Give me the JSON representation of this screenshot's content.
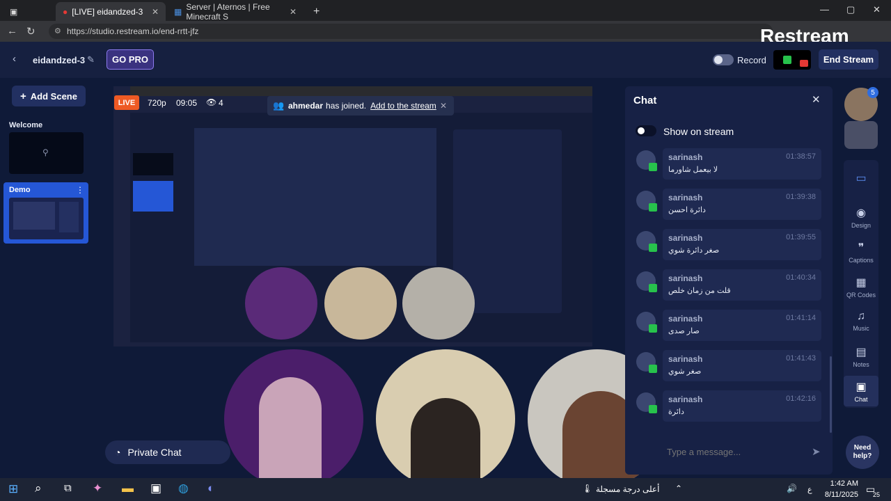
{
  "browser": {
    "tabs": [
      {
        "label": "[LIVE] eidandzed-3",
        "active": true
      },
      {
        "label": "Server | Aternos | Free Minecraft S",
        "active": false
      }
    ],
    "url": "https://studio.restream.io/end-rrtt-jfz",
    "logo": "Restream"
  },
  "header": {
    "project_name": "eidandzed-3",
    "go_pro": "GO PRO",
    "record_label": "Record",
    "end_stream": "End Stream"
  },
  "scenes": {
    "add_label": "Add Scene",
    "items": [
      {
        "label": "Welcome",
        "active": false
      },
      {
        "label": "Demo",
        "active": true
      }
    ]
  },
  "stage": {
    "live_badge": "LIVE",
    "resolution": "720p",
    "timer": "09:05",
    "viewers": "4",
    "toast_user": "ahmedar",
    "toast_text": "has joined.",
    "toast_link": "Add to the stream",
    "private_chat": "Private Chat"
  },
  "chat": {
    "title": "Chat",
    "show_on_stream": "Show on stream",
    "placeholder": "Type a message...",
    "messages": [
      {
        "user": "sarinash",
        "time": "01:38:57",
        "text": "لا بيعمل شاورما"
      },
      {
        "user": "sarinash",
        "time": "01:39:38",
        "text": "دائرة احسن"
      },
      {
        "user": "sarinash",
        "time": "01:39:55",
        "text": "صغر دائرة شوي"
      },
      {
        "user": "sarinash",
        "time": "01:40:34",
        "text": "قلت من زمان خلص"
      },
      {
        "user": "sarinash",
        "time": "01:41:14",
        "text": "صار صدى"
      },
      {
        "user": "sarinash",
        "time": "01:41:43",
        "text": "صغر شوي"
      },
      {
        "user": "sarinash",
        "time": "01:42:16",
        "text": "دائرة"
      }
    ]
  },
  "rightbar": {
    "badge": "5",
    "items": [
      {
        "label": "",
        "icon": "folder-icon"
      },
      {
        "label": "Design",
        "icon": "palette-icon"
      },
      {
        "label": "Captions",
        "icon": "captions-icon"
      },
      {
        "label": "QR Codes",
        "icon": "qr-icon"
      },
      {
        "label": "Music",
        "icon": "music-icon"
      },
      {
        "label": "Notes",
        "icon": "notes-icon"
      },
      {
        "label": "Chat",
        "icon": "chat-icon"
      }
    ],
    "need_help": "Need help?"
  },
  "taskbar": {
    "weather": "أعلى درجة مسجلة",
    "lang": "ع",
    "time": "1:42 AM",
    "date": "8/11/2025",
    "notif_count": "25"
  }
}
